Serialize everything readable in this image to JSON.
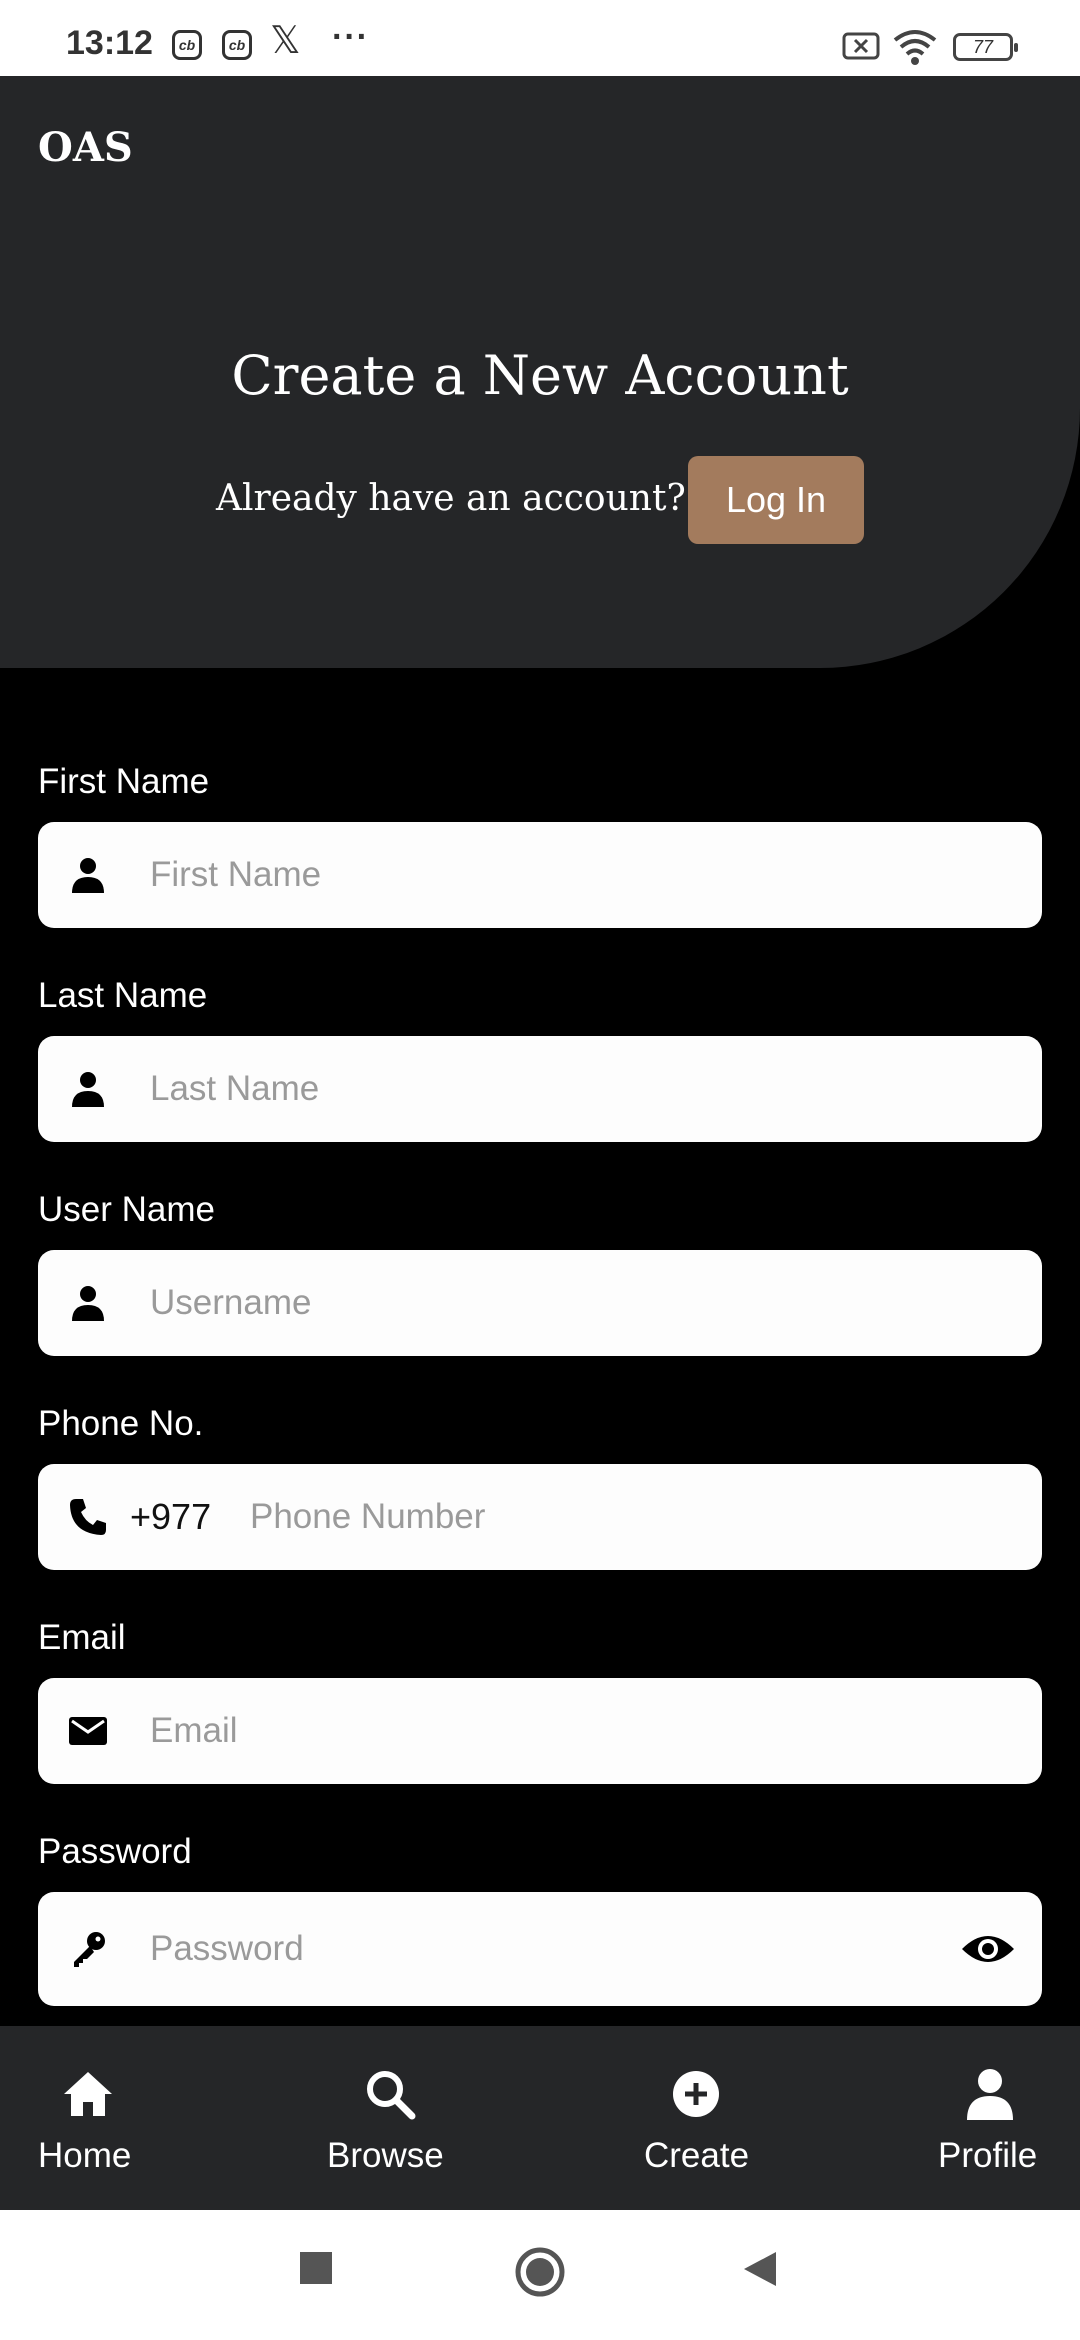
{
  "status_bar": {
    "time": "13:12",
    "icons": [
      "cb-app-icon",
      "cb-app-icon",
      "x-app-icon",
      "more-dots"
    ],
    "battery": "77"
  },
  "header": {
    "brand": "OAS",
    "title": "Create a New Account",
    "already_text": "Already have an account?",
    "login_label": "Log In"
  },
  "form": {
    "first_name": {
      "label": "First Name",
      "placeholder": "First Name",
      "icon": "person-icon"
    },
    "last_name": {
      "label": "Last Name",
      "placeholder": "Last Name",
      "icon": "person-icon"
    },
    "user_name": {
      "label": "User Name",
      "placeholder": "Username",
      "icon": "person-icon"
    },
    "phone": {
      "label": "Phone No.",
      "country_code": "+977",
      "placeholder": "Phone Number",
      "icon": "phone-icon"
    },
    "email": {
      "label": "Email",
      "placeholder": "Email",
      "icon": "mail-icon"
    },
    "password": {
      "label": "Password",
      "placeholder": "Password",
      "icon": "key-icon"
    }
  },
  "bottom_nav": {
    "items": [
      {
        "label": "Home",
        "icon": "home-icon"
      },
      {
        "label": "Browse",
        "icon": "search-icon"
      },
      {
        "label": "Create",
        "icon": "plus-circle-icon"
      },
      {
        "label": "Profile",
        "icon": "person-icon"
      }
    ]
  },
  "colors": {
    "background": "#000000",
    "header_bg": "#252628",
    "accent": "#a37b5d",
    "input_bg": "#fdfdfd"
  }
}
